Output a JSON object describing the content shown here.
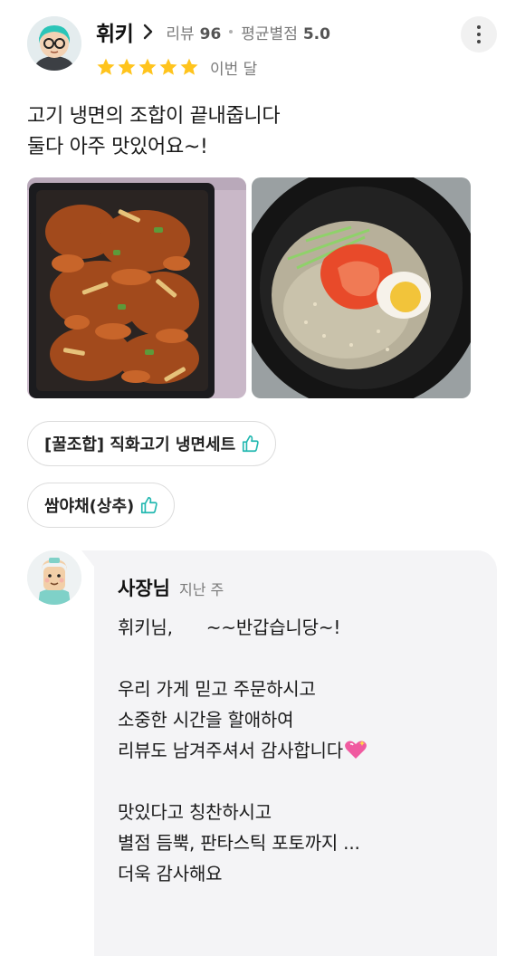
{
  "reviewer": {
    "name": "휘키",
    "review_count_label": "리뷰",
    "review_count": "96",
    "avg_rating_label": "평균별점",
    "avg_rating": "5.0",
    "rating_stars": 5,
    "date": "이번 달",
    "avatar_icon": "reviewer-avatar-icon"
  },
  "review": {
    "lines": [
      "고기 냉면의 조합이 끝내줍니다",
      "둘다 아주 맛있어요~!"
    ],
    "photos": [
      "photo-stir-fried-pork",
      "photo-cold-noodles"
    ]
  },
  "ordered_menus": [
    "[꿀조합] 직화고기 냉면세트",
    "쌈야채(상추)"
  ],
  "owner_reply": {
    "name": "사장님",
    "date": "지난 주",
    "lines": [
      "휘키님,      ~~반갑습니당~!",
      "",
      "우리 가게 믿고 주문하시고",
      "소중한 시간을 할애하여",
      "리뷰도 남겨주셔서 감사합니다",
      "",
      "맛있다고 칭찬하시고",
      "별점 듬뿍, 판타스틱 포토까지 ...",
      "더욱 감사해요"
    ]
  },
  "colors": {
    "star": "#ffc41d",
    "thumb": "#22b8b0",
    "reply_bg": "#f4f4f6",
    "heart": "#f05aa0"
  },
  "icons": {
    "more": "more-vertical-icon",
    "chevron": "chevron-right-icon",
    "star": "star-icon",
    "thumb": "thumbs-up-icon",
    "heart": "sparkling-heart-icon"
  }
}
